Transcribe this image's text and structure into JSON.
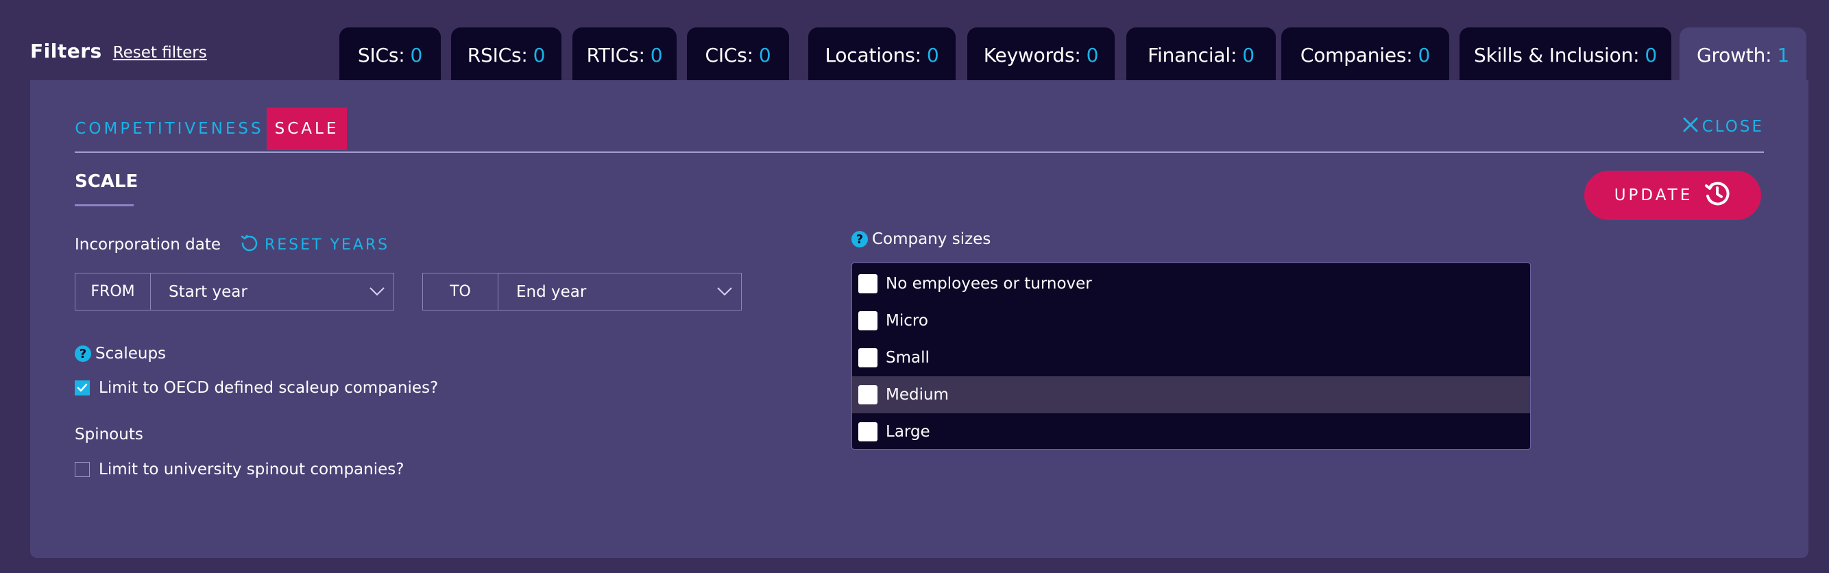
{
  "filters": {
    "title": "Filters",
    "reset_label": "Reset filters"
  },
  "tabs": [
    {
      "label": "SICs:",
      "count": "0"
    },
    {
      "label": "RSICs:",
      "count": "0"
    },
    {
      "label": "RTICs:",
      "count": "0"
    },
    {
      "label": "CICs:",
      "count": "0"
    },
    {
      "label": "Locations:",
      "count": "0"
    },
    {
      "label": "Keywords:",
      "count": "0"
    },
    {
      "label": "Financial:",
      "count": "0"
    },
    {
      "label": "Companies:",
      "count": "0"
    },
    {
      "label": "Skills & Inclusion:",
      "count": "0"
    },
    {
      "label": "Growth:",
      "count": "1"
    }
  ],
  "subtabs": {
    "competitiveness": "COMPETITIVENESS",
    "scale": "SCALE",
    "close": "CLOSE"
  },
  "section": {
    "title": "SCALE"
  },
  "update_button": {
    "label": "UPDATE"
  },
  "incorporation": {
    "label": "Incorporation date",
    "reset_years": "RESET YEARS",
    "from_label": "FROM",
    "from_value": "Start year",
    "to_label": "TO",
    "to_value": "End year"
  },
  "scaleups": {
    "label": "Scaleups",
    "checkbox_label": "Limit to OECD defined scaleup companies?",
    "checked": true
  },
  "spinouts": {
    "label": "Spinouts",
    "checkbox_label": "Limit to university spinout companies?",
    "checked": false
  },
  "company_sizes": {
    "label": "Company sizes",
    "options": [
      "No employees or turnover",
      "Micro",
      "Small",
      "Medium",
      "Large"
    ]
  },
  "colors": {
    "accent": "#1ab3e6",
    "brand": "#d4145a",
    "panel": "#4a4275",
    "dark": "#0c0727"
  }
}
